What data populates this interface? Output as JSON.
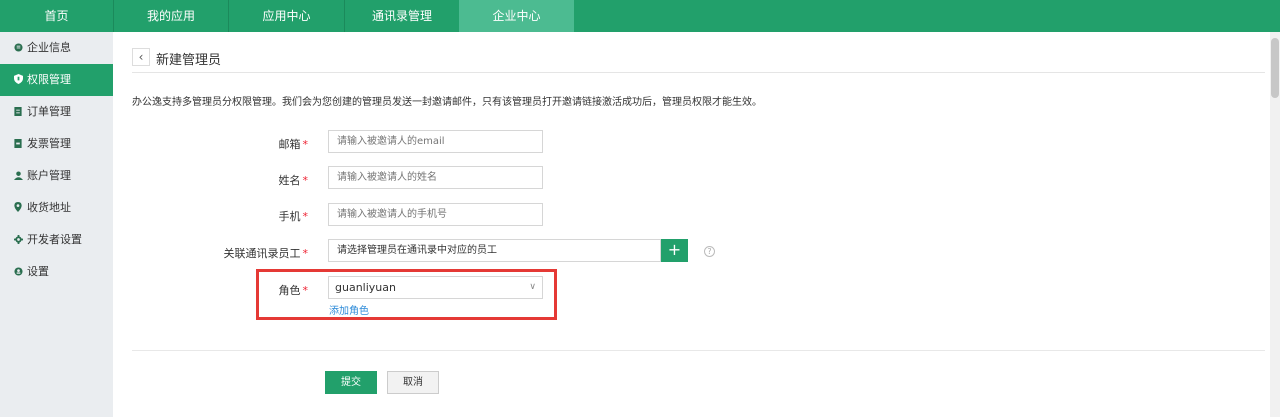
{
  "topnav": {
    "items": [
      {
        "label": "首页"
      },
      {
        "label": "我的应用"
      },
      {
        "label": "应用中心"
      },
      {
        "label": "通讯录管理"
      },
      {
        "label": "企业中心"
      }
    ],
    "active": "企业中心"
  },
  "sidebar": {
    "items": [
      {
        "label": "企业信息",
        "icon": "company-icon"
      },
      {
        "label": "权限管理",
        "icon": "shield-icon"
      },
      {
        "label": "订单管理",
        "icon": "order-icon"
      },
      {
        "label": "发票管理",
        "icon": "invoice-icon"
      },
      {
        "label": "账户管理",
        "icon": "user-icon"
      },
      {
        "label": "收货地址",
        "icon": "location-icon"
      },
      {
        "label": "开发者设置",
        "icon": "gear-icon"
      },
      {
        "label": "设置",
        "icon": "settings-icon"
      }
    ],
    "active": "权限管理"
  },
  "page": {
    "title": "新建管理员",
    "notice": "办公逸支持多管理员分权限管理。我们会为您创建的管理员发送一封邀请邮件，只有该管理员打开邀请链接激活成功后，管理员权限才能生效。"
  },
  "form": {
    "email": {
      "label": "邮箱",
      "placeholder": "请输入被邀请人的email",
      "value": ""
    },
    "name": {
      "label": "姓名",
      "placeholder": "请输入被邀请人的姓名",
      "value": ""
    },
    "phone": {
      "label": "手机",
      "placeholder": "请输入被邀请人的手机号",
      "value": ""
    },
    "employee": {
      "label": "关联通讯录员工",
      "value": "请选择管理员在通讯录中对应的员工"
    },
    "role": {
      "label": "角色",
      "value": "guanliyuan",
      "add_label": "添加角色"
    },
    "required_mark": "*"
  },
  "actions": {
    "submit": "提交",
    "cancel": "取消"
  },
  "colors": {
    "brand": "#22a06b",
    "highlight": "#e53935",
    "link": "#2e8bd8"
  }
}
